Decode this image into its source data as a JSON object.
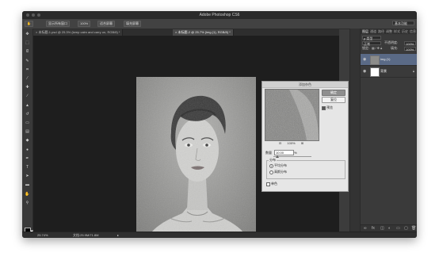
{
  "app": {
    "title": "Adobe Photoshop CS6"
  },
  "options_bar": {
    "buttons": [
      "显示所有窗口",
      "100%",
      "适合屏幕",
      "填充屏幕"
    ],
    "workspace": "基本功能"
  },
  "tabs": [
    {
      "label": "未标题-1.psd @ 25.3% (keep calm and carry on, RGB/8) *",
      "close": "×"
    },
    {
      "label": "未标题-2 @ 25.7% (img (1), RGB/8) *",
      "close": "×"
    }
  ],
  "dialog": {
    "title": "添加杂色",
    "ok": "确定",
    "reset": "复位",
    "preview_label": "预览",
    "preview_checked": true,
    "zoom_out": "⊟",
    "zoom_level": "100%",
    "zoom_in": "⊞",
    "amount_label": "数量",
    "amount_value": "10.00",
    "amount_unit": "%",
    "amount_fraction": 0.1,
    "distribution_label": "分布",
    "uniform_label": "平均分布",
    "gaussian_label": "高斯分布",
    "uniform_selected": true,
    "monochrome_label": "单色",
    "monochrome_checked": false
  },
  "panel": {
    "tabs": [
      "图层",
      "通道",
      "路径",
      "调整",
      "样式",
      "历史",
      "信息"
    ],
    "kind": "ρ 类型",
    "blend": "正常",
    "opacity_label": "不透明度:",
    "opacity_value": "100%",
    "lock_label": "锁定:",
    "fill_label": "填充:",
    "fill_value": "100%",
    "layers": [
      {
        "name": "img (1)",
        "selected": true,
        "locked": false
      },
      {
        "name": "背景",
        "selected": false,
        "locked": true
      }
    ]
  },
  "status": {
    "zoom": "25.74%",
    "doc": "文档:25.9M/71.8M",
    "arrow": "▸"
  },
  "icons": {
    "eye": "eye-icon",
    "lock": "lock-icon"
  }
}
